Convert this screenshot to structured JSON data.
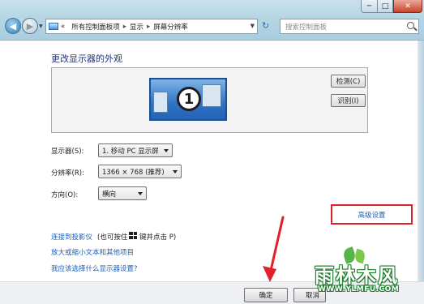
{
  "window": {
    "minimize_glyph": "─",
    "maximize_glyph": "□",
    "close_glyph": "✕"
  },
  "nav": {
    "back_glyph": "◀",
    "forward_glyph": "▶",
    "dropdown_glyph": "▼"
  },
  "address": {
    "prefix": "«",
    "crumbs": [
      "所有控制面板项",
      "显示",
      "屏幕分辨率"
    ],
    "separator": "▸",
    "dropdown_glyph": "▼",
    "refresh_glyph": "↻"
  },
  "search": {
    "placeholder": "搜索控制面板"
  },
  "main": {
    "heading": "更改显示器的外观",
    "monitor_number": "1",
    "detect_label": "检测(C)",
    "identify_label": "识别(I)",
    "display_label": "显示器(S):",
    "display_value": "1. 移动 PC 显示屏",
    "resolution_label": "分辨率(R):",
    "resolution_value": "1366 × 768 (推荐)",
    "orientation_label": "方向(O):",
    "orientation_value": "横向",
    "advanced_label": "高级设置",
    "projector_link": "连接到投影仪",
    "projector_hint_pre": "(也可按住",
    "projector_hint_post": "键并点击 P)",
    "text_size_link": "放大或缩小文本和其他项目",
    "help_link": "我应该选择什么显示器设置?"
  },
  "footer": {
    "ok_label": "确定",
    "cancel_label": "取消"
  },
  "watermark": {
    "brand": "雨林木风",
    "url": "WWW.YLMFU.COM"
  },
  "colors": {
    "link": "#1f5fb5",
    "highlight_box": "#e0202a",
    "annotation_arrow": "#e0202a"
  }
}
